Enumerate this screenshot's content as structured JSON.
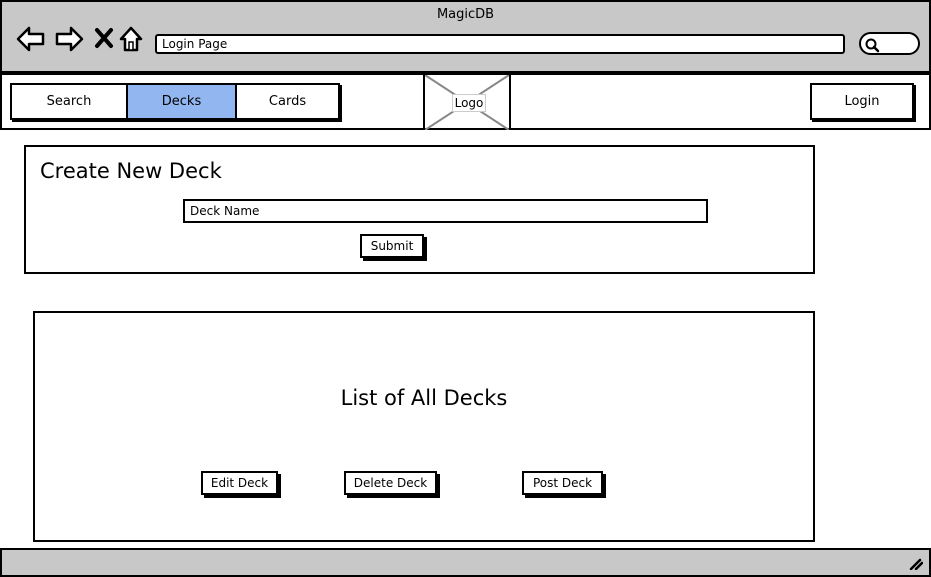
{
  "window": {
    "title": "MagicDB",
    "address": "Login Page"
  },
  "icons": {
    "back": "back-arrow-icon",
    "forward": "forward-arrow-icon",
    "stop": "close-x-icon",
    "home": "home-icon",
    "search": "search-icon",
    "resize": "resize-grip-icon"
  },
  "nav": {
    "tabs": [
      {
        "label": "Search",
        "active": false
      },
      {
        "label": "Decks",
        "active": true
      },
      {
        "label": "Cards",
        "active": false
      }
    ],
    "logo_label": "Logo",
    "login_label": "Login"
  },
  "create_deck": {
    "title": "Create New Deck",
    "deck_name_placeholder": "Deck Name",
    "submit_label": "Submit"
  },
  "deck_list": {
    "title": "List of All Decks",
    "actions": {
      "edit": "Edit Deck",
      "delete": "Delete Deck",
      "post": "Post Deck"
    }
  },
  "colors": {
    "chrome_gray": "#c8c8c8",
    "active_tab": "#92b6f0"
  }
}
